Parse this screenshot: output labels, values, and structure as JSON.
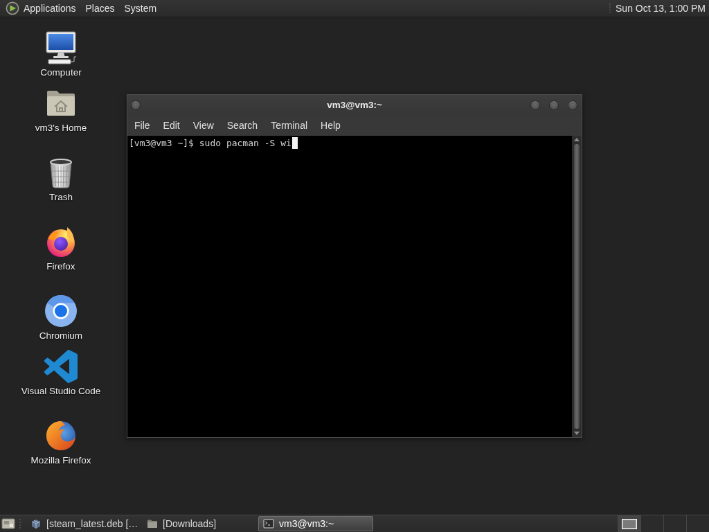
{
  "top_panel": {
    "menus": [
      {
        "label": "Applications",
        "kind": "logo"
      },
      {
        "label": "Places",
        "kind": "plain"
      },
      {
        "label": "System",
        "kind": "plain"
      }
    ],
    "clock": "Sun Oct 13, 1:00 PM"
  },
  "desktop_icons": [
    {
      "label": "Computer",
      "kind": "computer"
    },
    {
      "label": "vm3's Home",
      "kind": "home"
    },
    {
      "label": "Trash",
      "kind": "trash"
    },
    {
      "label": "Firefox",
      "kind": "firefox"
    },
    {
      "label": "Chromium",
      "kind": "chromium"
    },
    {
      "label": "Visual Studio Code",
      "kind": "vscode"
    },
    {
      "label": "Mozilla Firefox",
      "kind": "mozilla"
    }
  ],
  "window": {
    "title": "vm3@vm3:~",
    "menu": [
      "File",
      "Edit",
      "View",
      "Search",
      "Terminal",
      "Help"
    ],
    "terminal": {
      "lines": [
        "[vm3@vm3 ~]$ sudo pacman -S wi"
      ],
      "cursor": true
    }
  },
  "taskbar": {
    "tasks": [
      {
        "label": "[steam_latest.deb […",
        "kind": "package",
        "selected": false
      },
      {
        "label": "[Downloads]",
        "kind": "folder",
        "selected": false
      },
      {
        "label": "vm3@vm3:~",
        "kind": "terminal",
        "selected": true
      }
    ],
    "workspaces": [
      {
        "selected": true,
        "has_window": true
      },
      {
        "selected": false,
        "has_window": false
      },
      {
        "selected": false,
        "has_window": false
      },
      {
        "selected": false,
        "has_window": false
      }
    ]
  }
}
